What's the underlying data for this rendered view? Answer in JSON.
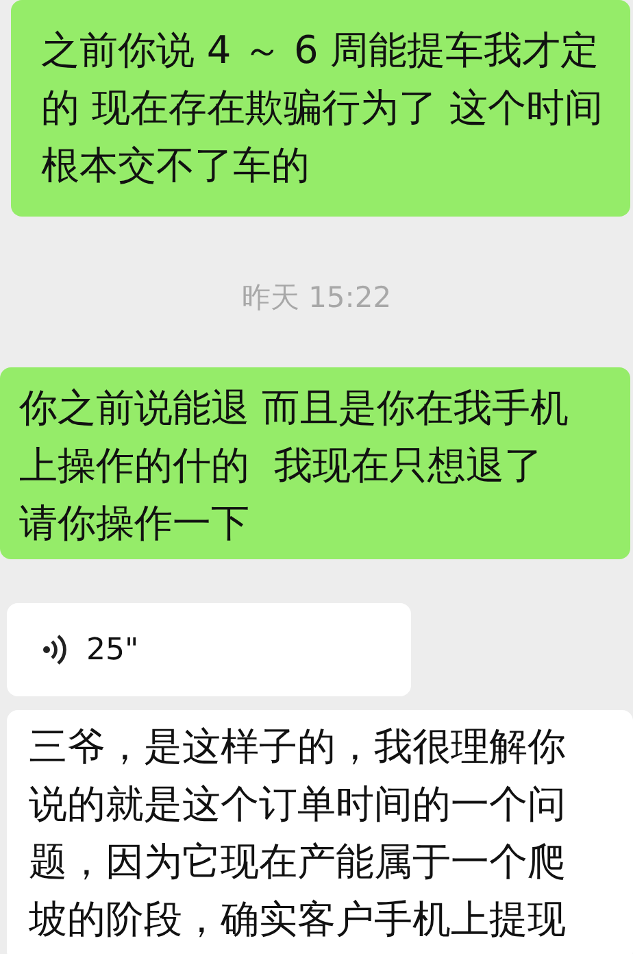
{
  "messages": [
    {
      "kind": "text",
      "outgoing": true,
      "text": "之前你说 4 ～ 6 周能提车我才定的 现在存在欺骗行为了 这个时间根本交不了车的"
    },
    {
      "kind": "time",
      "text": "昨天 15:22"
    },
    {
      "kind": "text",
      "outgoing": true,
      "text": "你之前说能退 而且是你在我手机上操作的什的  我现在只想退了请你操作一下"
    },
    {
      "kind": "voice",
      "outgoing": false,
      "duration": "25\""
    },
    {
      "kind": "text",
      "outgoing": false,
      "text": "三爷，是这样子的，我很理解你说的就是这个订单时间的一个问题，因为它现在产能属于一个爬坡的阶段，确实客户手机上提现"
    }
  ]
}
